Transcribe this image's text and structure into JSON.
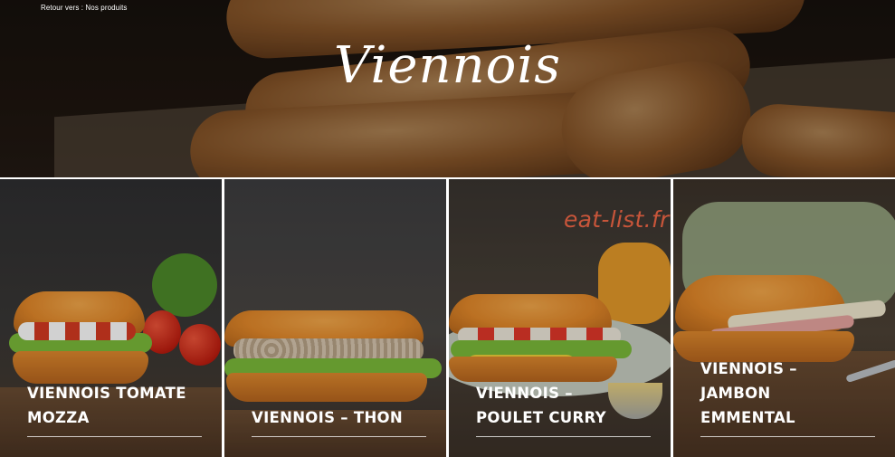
{
  "breadcrumb": {
    "prefix": "Retour vers :",
    "link": "Nos produits"
  },
  "hero": {
    "title": "Viennois"
  },
  "products": [
    {
      "line1": "VIENNOIS TOMATE",
      "line2": "MOZZA",
      "line3": ""
    },
    {
      "line1": "VIENNOIS – THON",
      "line2": "",
      "line3": ""
    },
    {
      "line1": "VIENNOIS –",
      "line2": "POULET CURRY",
      "line3": ""
    },
    {
      "line1": "VIENNOIS –",
      "line2": "JAMBON",
      "line3": "EMMENTAL"
    }
  ],
  "watermark": "eat-list.fr"
}
